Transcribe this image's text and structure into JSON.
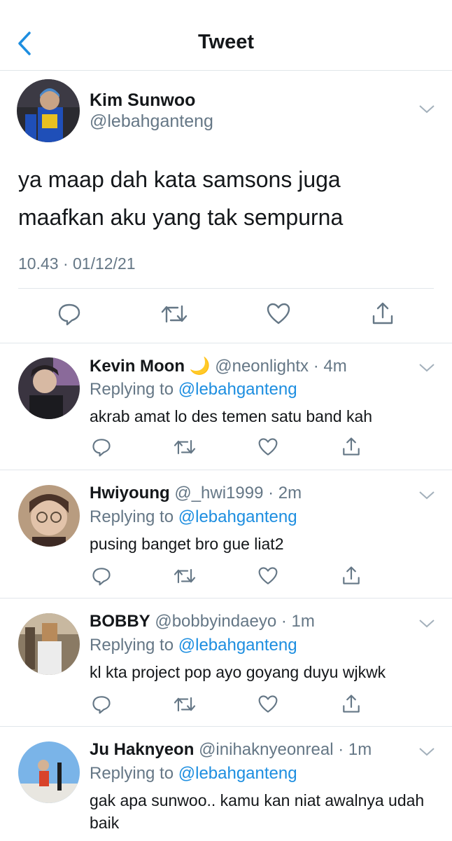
{
  "header": {
    "title": "Tweet"
  },
  "main_tweet": {
    "name": "Kim Sunwoo",
    "handle": "@lebahganteng",
    "text_lines": [
      "ya maap dah kata samsons juga",
      "maafkan aku yang tak sempurna"
    ],
    "timestamp": "10.43 · 01/12/21"
  },
  "replies": [
    {
      "name": "Kevin Moon",
      "emoji": "🌙",
      "handle": "@neonlightx",
      "time": "· 4m",
      "replying_prefix": "Replying to",
      "replying_to": "@lebahganteng",
      "text": "akrab amat lo des temen satu band kah"
    },
    {
      "name": "Hwiyoung",
      "emoji": "",
      "handle": "@_hwi1999",
      "time": "· 2m",
      "replying_prefix": "Replying to",
      "replying_to": "@lebahganteng",
      "text": "pusing banget bro gue liat2"
    },
    {
      "name": "BOBBY",
      "emoji": "",
      "handle": "@bobbyindaeyo",
      "time": "· 1m",
      "replying_prefix": "Replying to",
      "replying_to": "@lebahganteng",
      "text": "kl kta project pop ayo goyang duyu wjkwk"
    },
    {
      "name": "Ju Haknyeon",
      "emoji": "",
      "handle": "@inihaknyeonreal",
      "time": "· 1m",
      "replying_prefix": "Replying to",
      "replying_to": "@lebahganteng",
      "text": "gak apa sunwoo.. kamu kan niat awalnya udah baik"
    }
  ],
  "icons": {
    "back": "chevron-left-icon",
    "more": "chevron-down-icon",
    "reply": "reply-bubble-icon",
    "retweet": "retweet-icon",
    "like": "heart-icon",
    "share": "share-icon"
  },
  "colors": {
    "accent": "#1d8ee0",
    "secondary_text": "#657786",
    "primary_text": "#14171a",
    "divider": "#e1e6ea"
  }
}
